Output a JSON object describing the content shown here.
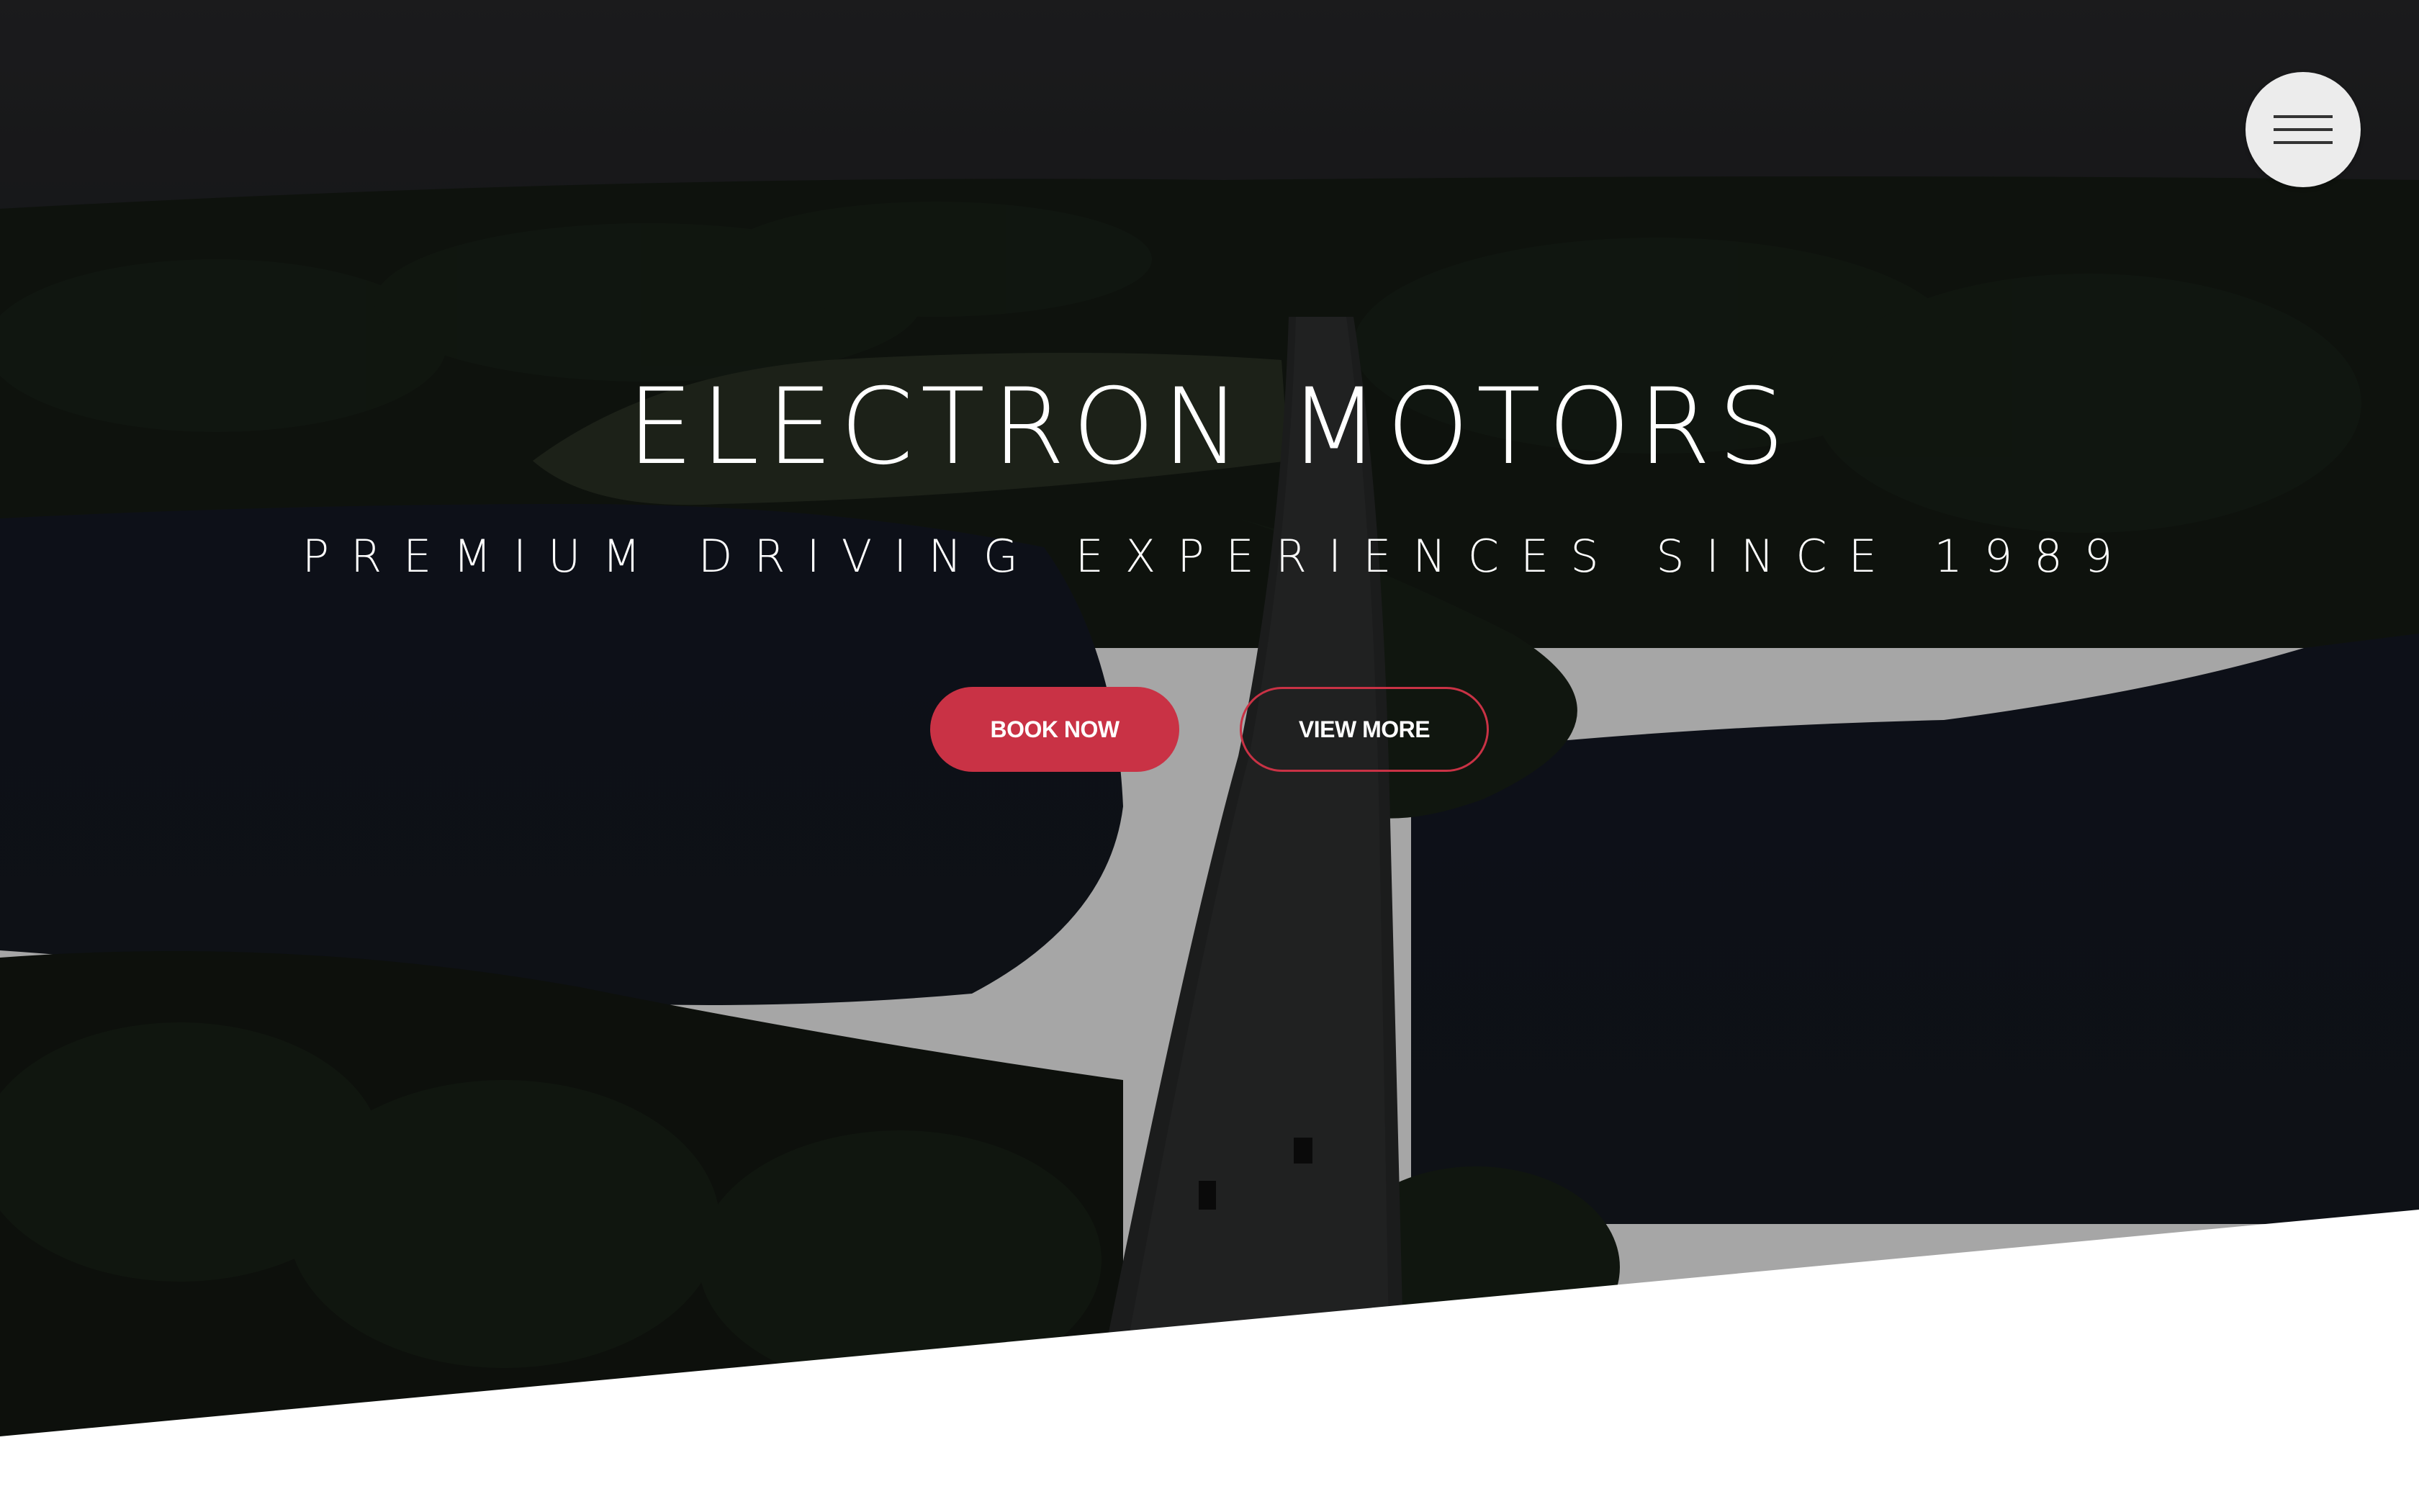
{
  "hero": {
    "title": "ELECTRON MOTORS",
    "subtitle": "PREMIUM DRIVING EXPERIENCES SINCE 1989",
    "background": "aerial-lake-bridge-photo"
  },
  "buttons": {
    "book_now": "BOOK NOW",
    "view_more": "VIEW MORE"
  },
  "menu": {
    "icon": "hamburger-menu-icon"
  },
  "colors": {
    "accent": "#c93245",
    "overlay": "#1b1d1f",
    "background": "#ffffff"
  }
}
